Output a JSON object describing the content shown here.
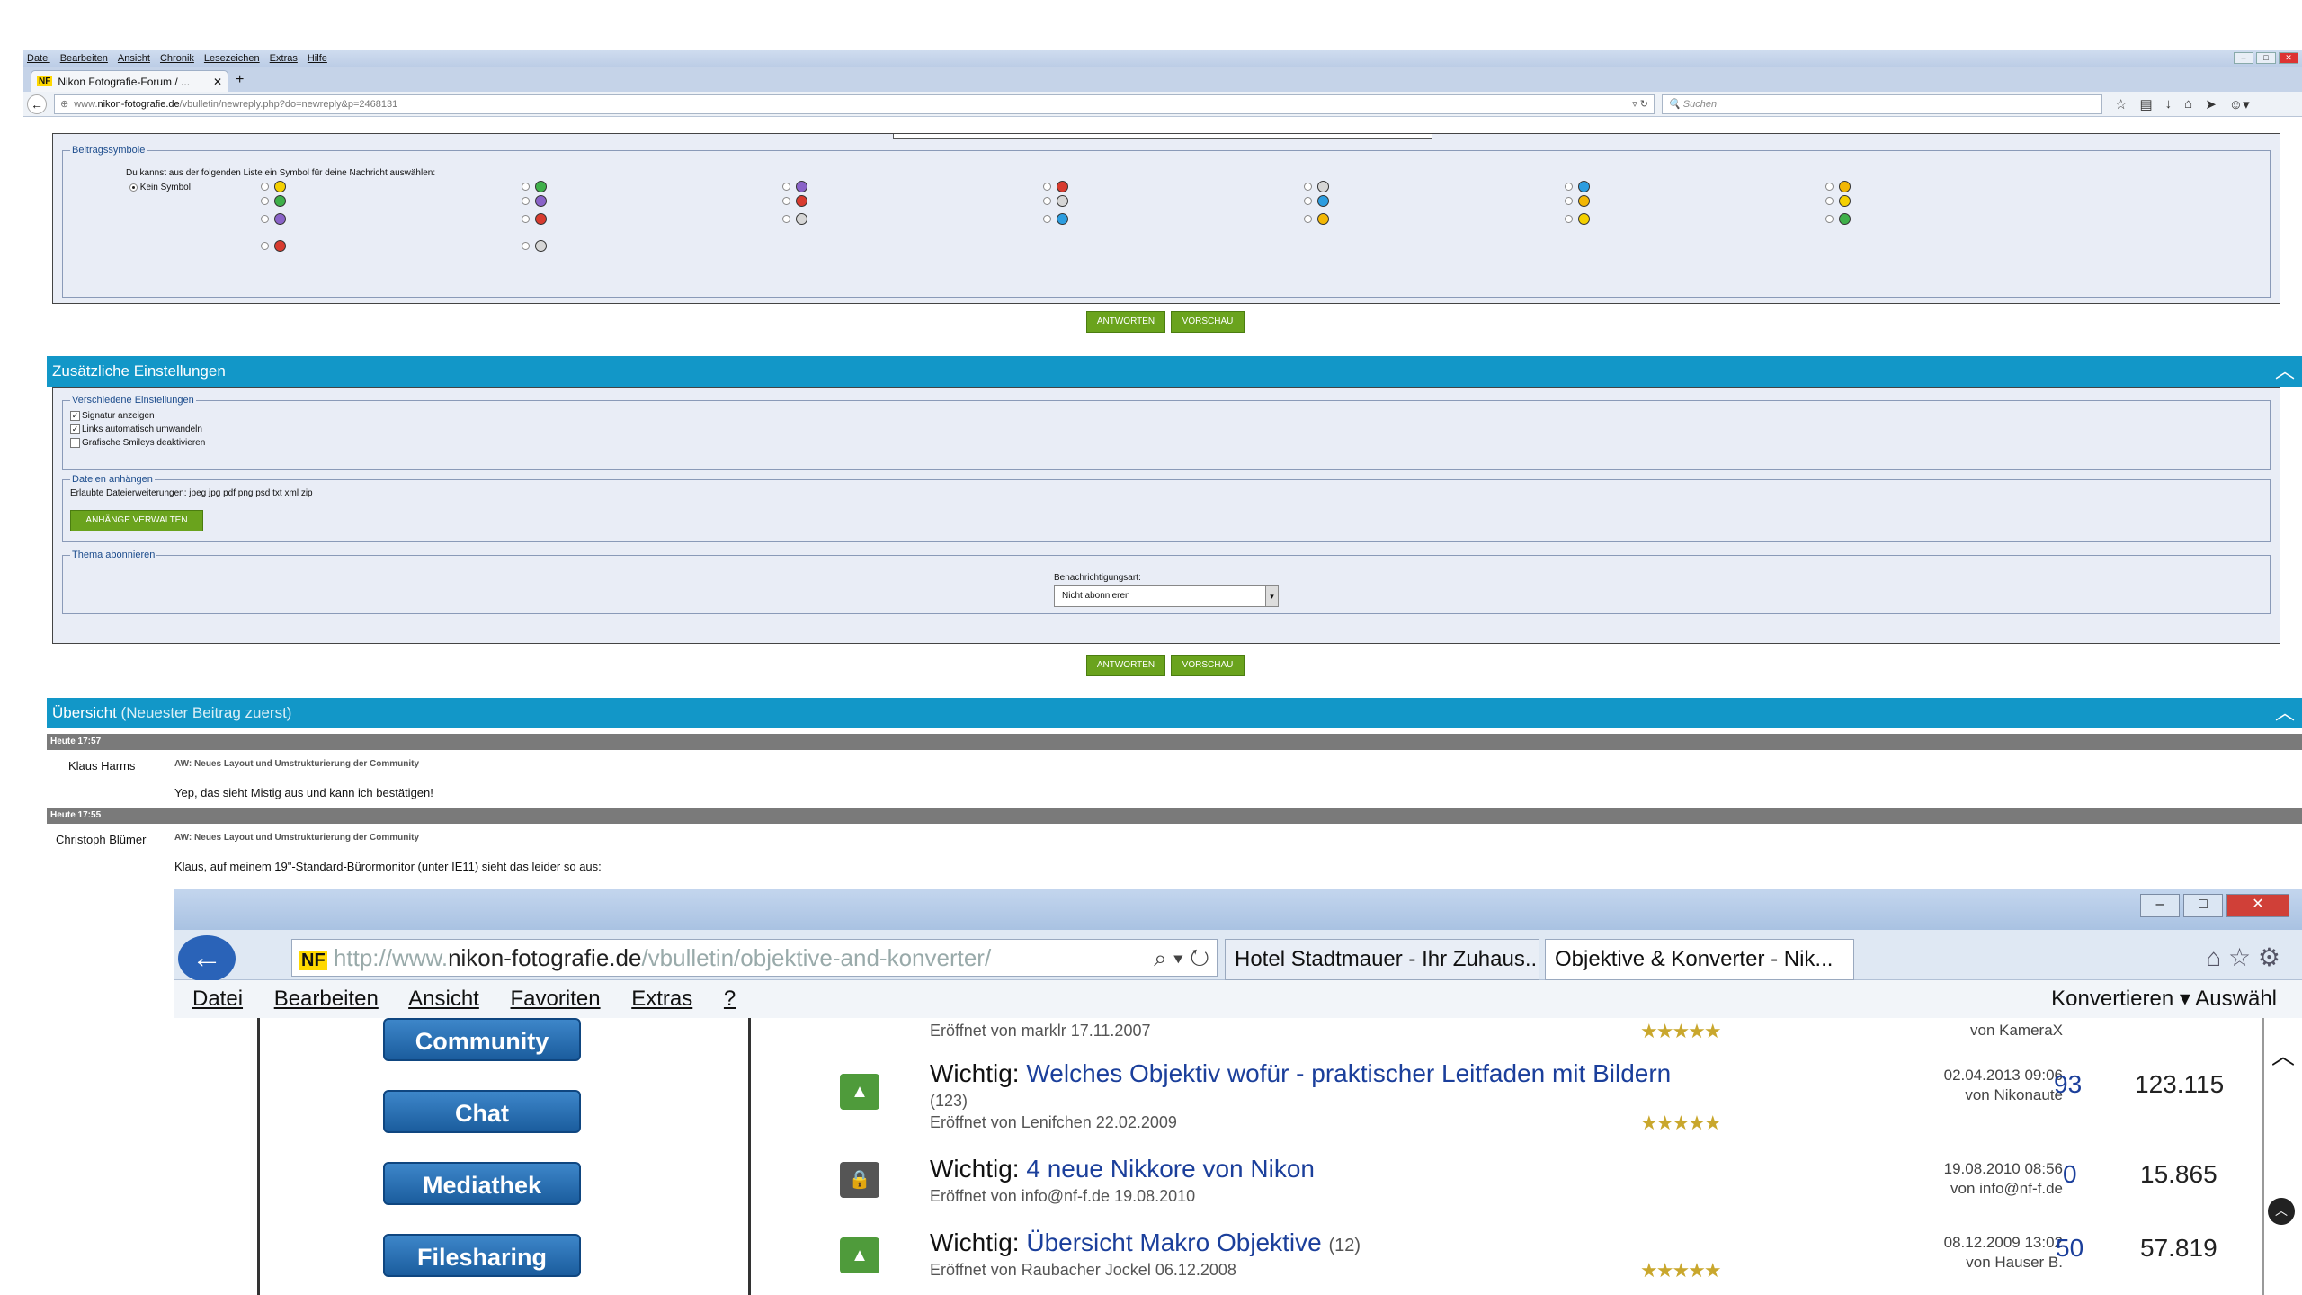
{
  "browser": {
    "menu": [
      "Datei",
      "Bearbeiten",
      "Ansicht",
      "Chronik",
      "Lesezeichen",
      "Extras",
      "Hilfe"
    ],
    "tab_title": "Nikon Fotografie-Forum / ...",
    "tab_badge": "NF",
    "url_prefix": "www.",
    "url_domain": "nikon-fotografie.de",
    "url_path": "/vbulletin/newreply.php?do=newreply&p=2468131",
    "search_placeholder": "Suchen"
  },
  "symbols": {
    "legend": "Beitragssymbole",
    "intro": "Du kannst aus der folgenden Liste ein Symbol für deine Nachricht auswählen:",
    "none_label": "Kein Symbol"
  },
  "buttons": {
    "reply": "ANTWORTEN",
    "preview": "VORSCHAU",
    "attach": "ANHÄNGE VERWALTEN"
  },
  "additional": {
    "title": "Zusätzliche Einstellungen",
    "misc_legend": "Verschiedene Einstellungen",
    "options": [
      "Signatur anzeigen",
      "Links automatisch umwandeln",
      "Grafische Smileys deaktivieren"
    ],
    "files_legend": "Dateien anhängen",
    "allowed": "Erlaubte Dateierweiterungen: jpeg jpg pdf png psd txt xml zip",
    "subscribe_legend": "Thema abonnieren",
    "notify_label": "Benachrichtigungsart:",
    "notify_value": "Nicht abonnieren"
  },
  "overview": {
    "title": "Übersicht",
    "subtitle": "(Neuester Beitrag zuerst)",
    "posts": [
      {
        "time": "Heute 17:57",
        "author": "Klaus Harms",
        "title": "AW: Neues Layout und Umstrukturierung der Community",
        "text": "Yep, das sieht Mistig aus und kann ich bestätigen!"
      },
      {
        "time": "Heute 17:55",
        "author": "Christoph Blümer",
        "title": "AW: Neues Layout und Umstrukturierung der Community",
        "text": "Klaus, auf meinem 19\"-Standard-Bürormonitor (unter IE11) sieht das leider so aus:"
      }
    ]
  },
  "screenshot": {
    "url_prefix": "http://www.",
    "url_domain": "nikon-fotografie.de",
    "url_path": "/vbulletin/objektive-and-konverter/",
    "tab1": "Hotel Stadtmauer - Ihr Zuhaus...",
    "tab2": "Objektive & Konverter - Nik...",
    "menu": [
      "Datei",
      "Bearbeiten",
      "Ansicht",
      "Favoriten",
      "Extras",
      "?"
    ],
    "menu_right": "Konvertieren  ▾  Auswähl",
    "nav_buttons": [
      "Community",
      "Chat",
      "Mediathek",
      "Filesharing"
    ],
    "top_row": {
      "sub": "Eröffnet von marklr 17.11.2007",
      "by": "von KameraX"
    },
    "topics": [
      {
        "prefix": "Wichtig:",
        "title": "Welches Objektiv wofür - praktischer Leitfaden mit Bildern",
        "pages": "(123)",
        "sub": "Eröffnet von Lenifchen 22.02.2009",
        "date": "02.04.2013 09:06",
        "by": "von Nikonaute",
        "replies": "93",
        "views": "123.115"
      },
      {
        "prefix": "Wichtig:",
        "title": "4 neue Nikkore von Nikon",
        "pages": "",
        "sub": "Eröffnet von info@nf-f.de 19.08.2010",
        "date": "19.08.2010 08:56",
        "by": "von info@nf-f.de",
        "replies": "0",
        "views": "15.865"
      },
      {
        "prefix": "Wichtig:",
        "title": "Übersicht Makro Objektive",
        "pages": "(12)",
        "sub": "Eröffnet von Raubacher Jockel 06.12.2008",
        "date": "08.12.2009 13:02",
        "by": "von Hauser B.",
        "replies": "50",
        "views": "57.819"
      }
    ]
  }
}
